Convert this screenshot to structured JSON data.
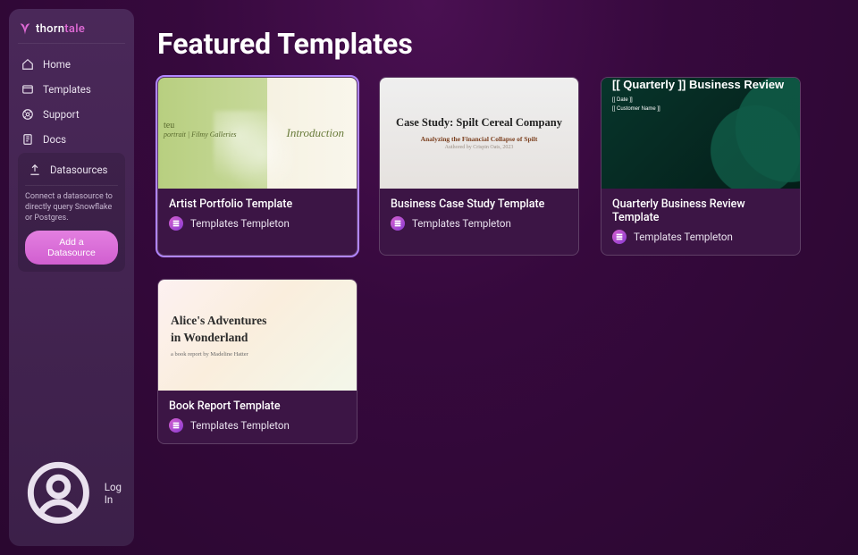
{
  "brand": {
    "name_plain": "thorn",
    "name_accent": "tale"
  },
  "nav": {
    "home": "Home",
    "templates": "Templates",
    "support": "Support",
    "docs": "Docs"
  },
  "datasources": {
    "header": "Datasources",
    "description": "Connect a datasource to directly query Snowflake or Postgres.",
    "button": "Add a Datasource"
  },
  "footer": {
    "login": "Log In"
  },
  "page": {
    "title": "Featured Templates"
  },
  "templates": [
    {
      "id": "artist",
      "title": "Artist Portfolio Template",
      "author": "Templates Templeton",
      "selected": true,
      "thumb": {
        "variant": "artist",
        "left_caption": "teu",
        "left_sub": "portrait | Filmy Galleries",
        "right_word": "Introduction"
      }
    },
    {
      "id": "case",
      "title": "Business Case Study Template",
      "author": "Templates Templeton",
      "selected": false,
      "thumb": {
        "variant": "case",
        "headline": "Case Study: Spilt Cereal Company",
        "subhead": "Analyzing the Financial Collapse of Spilt",
        "byline": "Authored by Crispin Oats, 2023"
      }
    },
    {
      "id": "qbr",
      "title": "Quarterly Business Review Template",
      "author": "Templates Templeton",
      "selected": false,
      "thumb": {
        "variant": "qbr",
        "headline": "[[ Quarterly ]] Business Review",
        "meta1": "[[ Date ]]",
        "meta2": "[[ Customer Name ]]"
      }
    },
    {
      "id": "book",
      "title": "Book Report Template",
      "author": "Templates Templeton",
      "selected": false,
      "thumb": {
        "variant": "book",
        "line1": "Alice's Adventures",
        "line2": "in Wonderland",
        "byline": "a book report by Madeline Hatter"
      }
    }
  ]
}
